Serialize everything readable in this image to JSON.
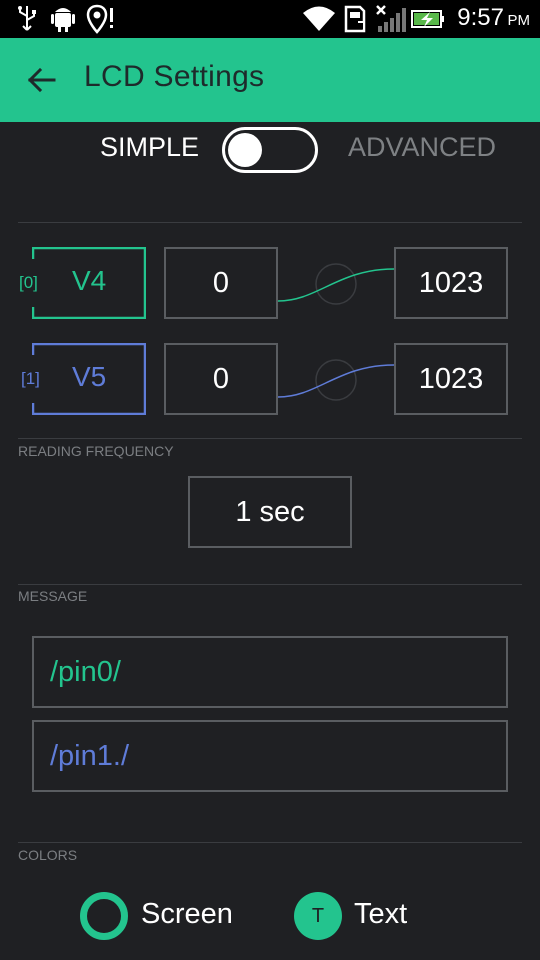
{
  "status_bar": {
    "time": "9:57",
    "ampm": "PM",
    "icons": [
      "usb-icon",
      "android-debug-icon",
      "location-alert-icon",
      "wifi-icon",
      "sd-card-icon",
      "no-signal-icon",
      "battery-charging-icon"
    ]
  },
  "app_bar": {
    "title": "LCD Settings",
    "back_icon": "arrow-back-icon"
  },
  "mode": {
    "left_label": "SIMPLE",
    "right_label": "ADVANCED",
    "selected": "SIMPLE"
  },
  "pins": [
    {
      "index": "[0]",
      "name": "V4",
      "min": "0",
      "max": "1023",
      "color": "#23c48e"
    },
    {
      "index": "[1]",
      "name": "V5",
      "min": "0",
      "max": "1023",
      "color": "#5f7cd8"
    }
  ],
  "reading_frequency": {
    "label": "READING FREQUENCY",
    "value": "1 sec"
  },
  "message": {
    "label": "MESSAGE",
    "lines": [
      {
        "text": "/pin0/",
        "color": "#23c48e"
      },
      {
        "text": "/pin1./",
        "color": "#5f7cd8"
      }
    ]
  },
  "colors": {
    "label": "COLORS",
    "screen_label": "Screen",
    "text_label": "Text",
    "text_swatch_letter": "T",
    "accent": "#23c48e"
  }
}
